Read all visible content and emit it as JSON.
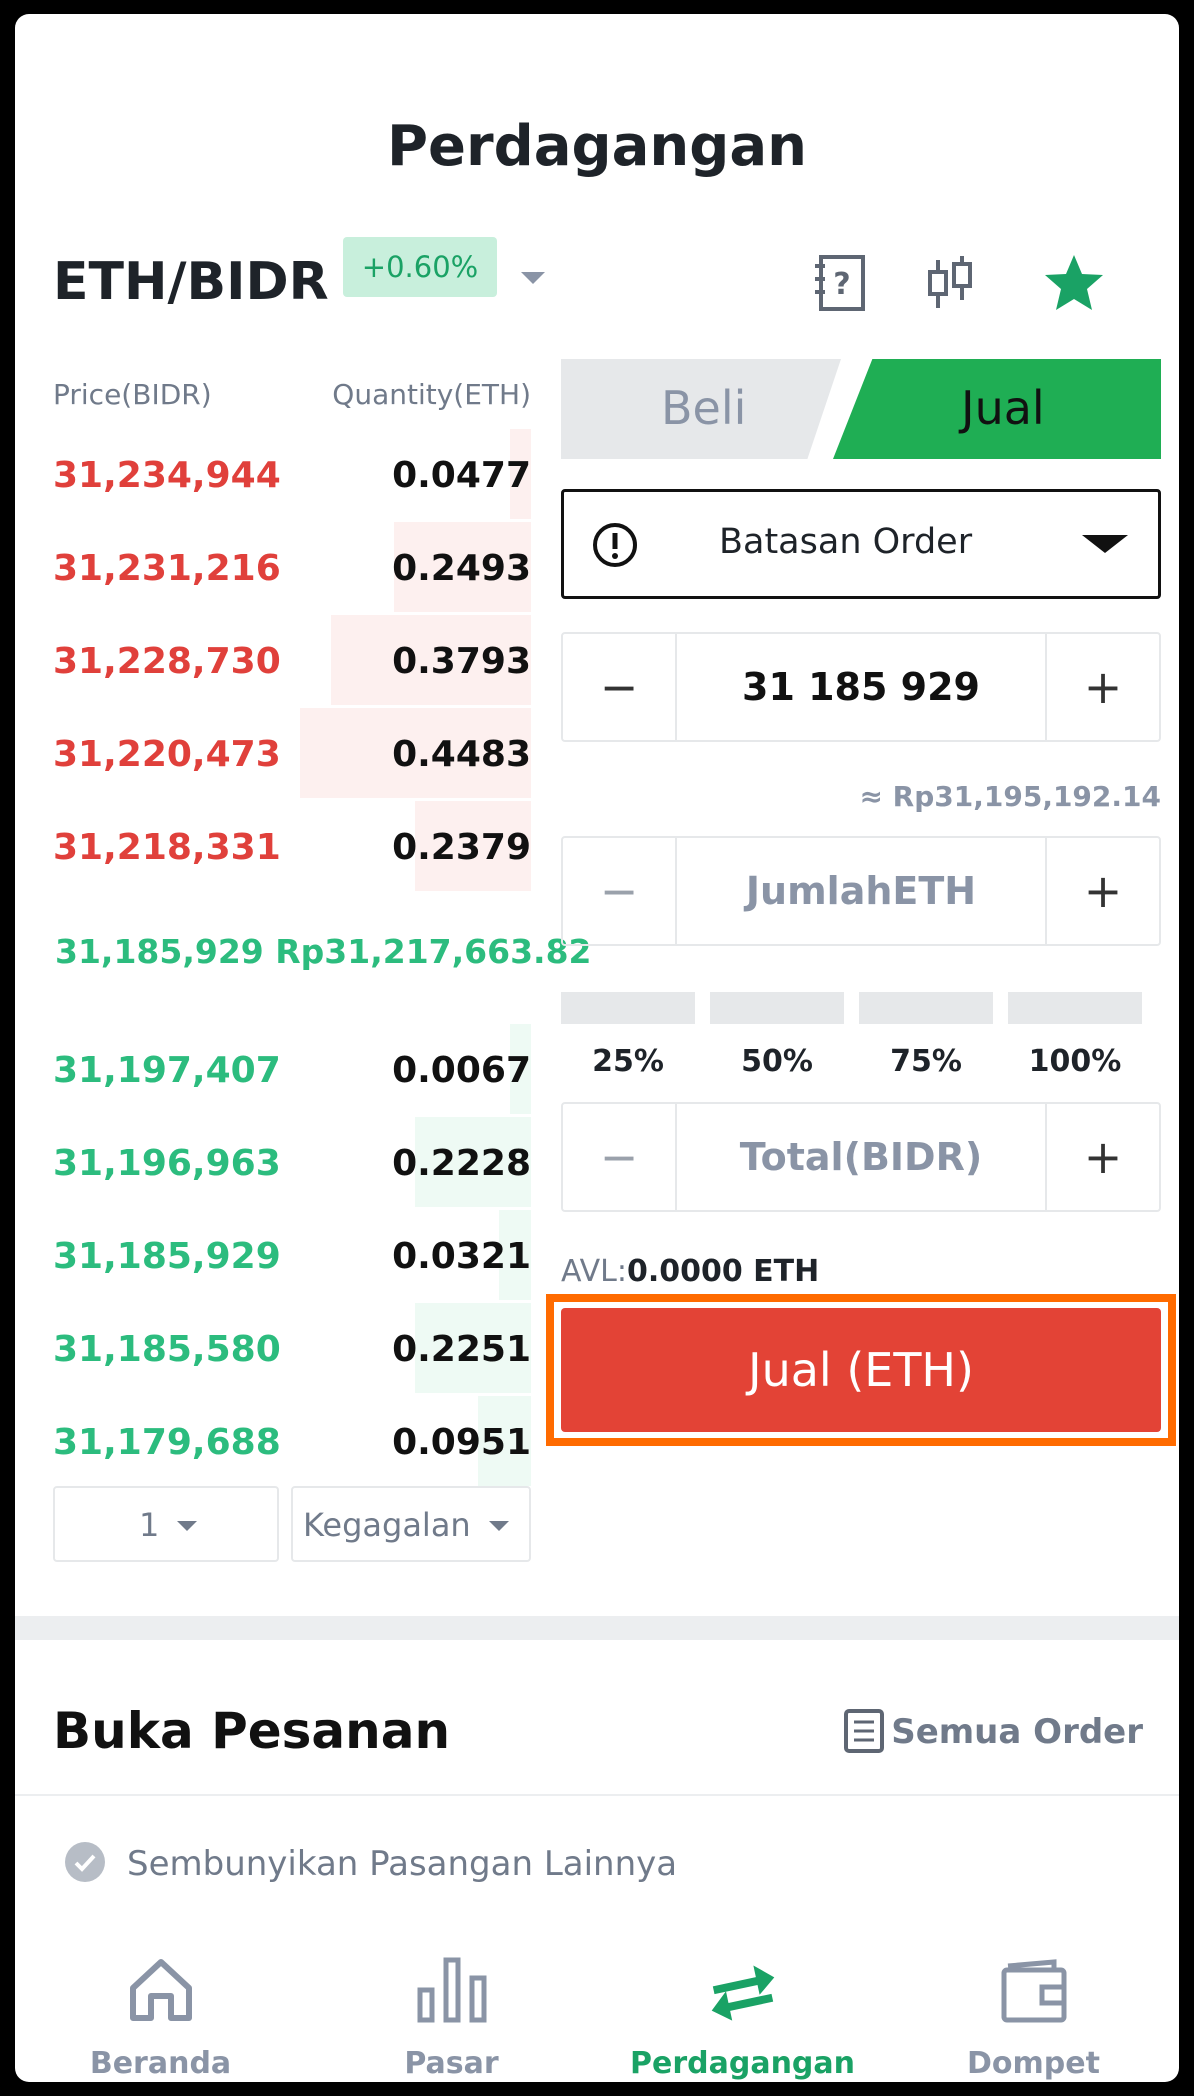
{
  "header": {
    "title": "Perdagangan"
  },
  "pair": {
    "symbol": "ETH/BIDR",
    "change": "+0.60%"
  },
  "orderbook": {
    "price_header": "Price(BIDR)",
    "qty_header": "Quantity(ETH)",
    "asks": [
      {
        "price": "31,234,944",
        "qty": "0.0477",
        "depth": 0.02
      },
      {
        "price": "31,231,216",
        "qty": "0.2493",
        "depth": 0.13
      },
      {
        "price": "31,228,730",
        "qty": "0.3793",
        "depth": 0.19
      },
      {
        "price": "31,220,473",
        "qty": "0.4483",
        "depth": 0.22
      },
      {
        "price": "31,218,331",
        "qty": "0.2379",
        "depth": 0.11
      }
    ],
    "mid_price": "31,185,929",
    "mid_fiat": "Rp31,217,663.82",
    "bids": [
      {
        "price": "31,197,407",
        "qty": "0.0067",
        "depth": 0.02
      },
      {
        "price": "31,196,963",
        "qty": "0.2228",
        "depth": 0.11
      },
      {
        "price": "31,185,929",
        "qty": "0.0321",
        "depth": 0.03
      },
      {
        "price": "31,185,580",
        "qty": "0.2251",
        "depth": 0.11
      },
      {
        "price": "31,179,688",
        "qty": "0.0951",
        "depth": 0.05
      }
    ],
    "precision": "1",
    "mode": "Kegagalan"
  },
  "trade": {
    "buy_tab": "Beli",
    "sell_tab": "Jual",
    "order_type": "Batasan Order",
    "price_value": "31 185 929",
    "approx": "≈ Rp31,195,192.14",
    "amount_placeholder": "JumlahETH",
    "percents": [
      "25%",
      "50%",
      "75%",
      "100%"
    ],
    "total_placeholder": "Total(BIDR)",
    "avl_label": "AVL:",
    "avl_value": "0.0000 ETH",
    "submit": "Jual (ETH)",
    "minus": "−",
    "plus": "+"
  },
  "orders": {
    "title": "Buka Pesanan",
    "all_orders": "Semua Order",
    "hide_pairs": "Sembunyikan Pasangan Lainnya"
  },
  "nav": {
    "items": [
      {
        "label": "Beranda",
        "icon": "home-icon"
      },
      {
        "label": "Pasar",
        "icon": "bar-chart-icon"
      },
      {
        "label": "Perdagangan",
        "icon": "swap-arrows-icon"
      },
      {
        "label": "Dompet",
        "icon": "wallet-icon"
      }
    ]
  },
  "colors": {
    "sell_red": "#e34336",
    "buy_green": "#2cbc7e",
    "active_green": "#1fae54",
    "highlight": "#ff6b00"
  }
}
